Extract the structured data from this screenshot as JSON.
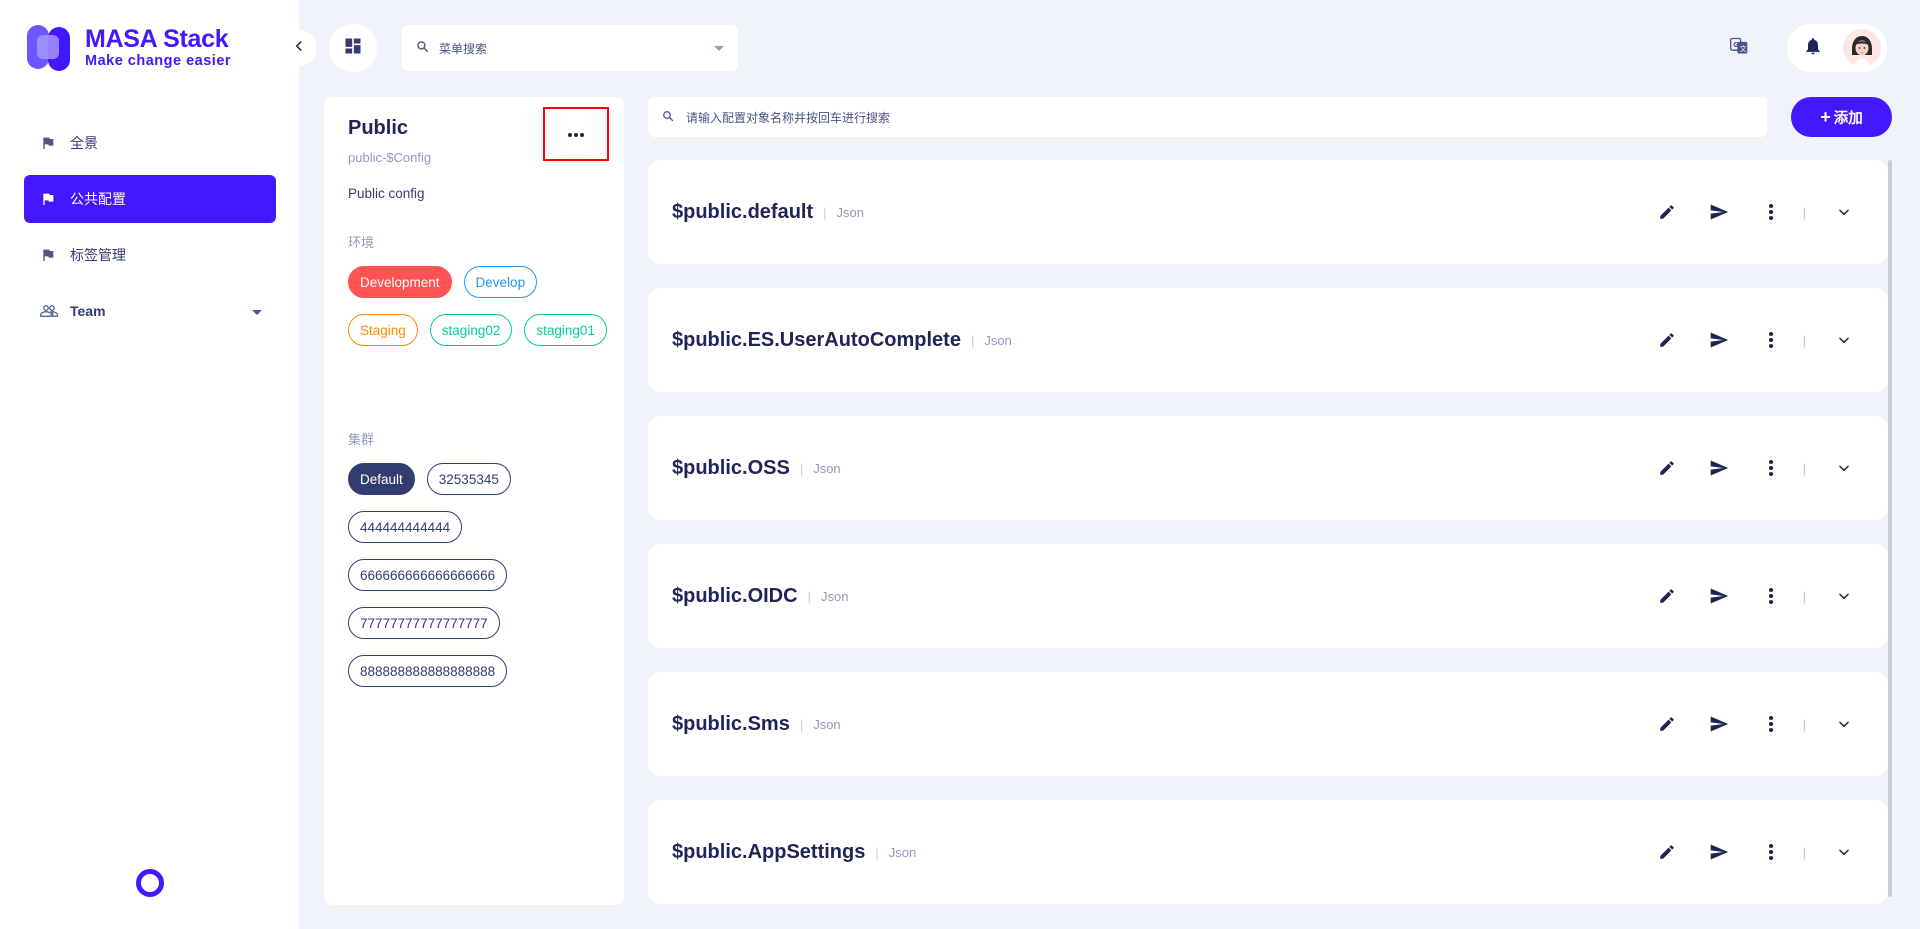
{
  "brand": {
    "title": "MASA Stack",
    "subtitle": "Make change easier"
  },
  "sidebar": {
    "items": [
      {
        "label": "全景"
      },
      {
        "label": "公共配置"
      },
      {
        "label": "标签管理"
      }
    ],
    "team_label": "Team"
  },
  "topbar": {
    "menu_search_placeholder": "菜单搜索"
  },
  "panel": {
    "title": "Public",
    "subtitle": "public-$Config",
    "description": "Public config",
    "env_label": "环境",
    "environments": [
      "Development",
      "Develop",
      "Staging",
      "staging02",
      "staging01"
    ],
    "cluster_label": "集群",
    "clusters": [
      "Default",
      "32535345",
      "444444444444",
      "666666666666666666",
      "77777777777777777",
      "888888888888888888"
    ]
  },
  "main": {
    "search_placeholder": "请输入配置对象名称并按回车进行搜索",
    "add_label": "添加",
    "add_symbol": "+",
    "objects": [
      {
        "name": "$public.default",
        "type": "Json"
      },
      {
        "name": "$public.ES.UserAutoComplete",
        "type": "Json"
      },
      {
        "name": "$public.OSS",
        "type": "Json"
      },
      {
        "name": "$public.OIDC",
        "type": "Json"
      },
      {
        "name": "$public.Sms",
        "type": "Json"
      },
      {
        "name": "$public.AppSettings",
        "type": "Json"
      }
    ],
    "separator": "|"
  },
  "colors": {
    "primary": "#4318ff",
    "text": "#323d6f",
    "muted": "#8f9bba",
    "development": "#ff5252",
    "develop": "#2196f3",
    "staging": "#fb8c00",
    "staging02": "#05cd99",
    "staging01": "#05cd99",
    "cluster_active": "#323d6f"
  }
}
